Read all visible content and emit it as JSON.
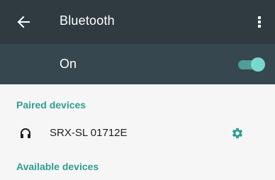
{
  "appbar": {
    "title": "Bluetooth",
    "back_icon": "arrow-left-icon",
    "menu_icon": "more-vert-icon",
    "background": "#2f3b40"
  },
  "switch": {
    "label": "On",
    "state": "on",
    "accent": "#79d8cd",
    "background": "#37474f"
  },
  "paired": {
    "header": "Paired devices",
    "devices": [
      {
        "name": "SRX-SL 01712E",
        "icon": "headphones-icon",
        "action_icon": "gear-icon"
      }
    ]
  },
  "available": {
    "header": "Available devices"
  },
  "colors": {
    "section_header": "#2e9d93",
    "content_background": "#f6f6f6"
  }
}
